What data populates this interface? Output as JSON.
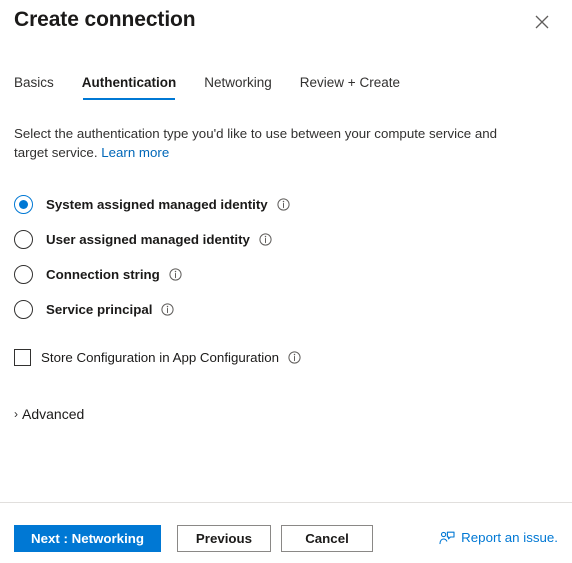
{
  "dialog": {
    "title": "Create connection",
    "close_icon": "close-icon"
  },
  "tabs": [
    {
      "label": "Basics",
      "active": false
    },
    {
      "label": "Authentication",
      "active": true
    },
    {
      "label": "Networking",
      "active": false
    },
    {
      "label": "Review + Create",
      "active": false
    }
  ],
  "description": {
    "text": "Select the authentication type you'd like to use between your compute service and target service.",
    "link_label": "Learn more"
  },
  "auth_options": [
    {
      "label": "System assigned managed identity",
      "selected": true,
      "info_icon": "info-icon"
    },
    {
      "label": "User assigned managed identity",
      "selected": false,
      "info_icon": "info-icon"
    },
    {
      "label": "Connection string",
      "selected": false,
      "info_icon": "info-icon"
    },
    {
      "label": "Service principal",
      "selected": false,
      "info_icon": "info-icon"
    }
  ],
  "store_config": {
    "label": "Store Configuration in App Configuration",
    "checked": false,
    "info_icon": "info-icon"
  },
  "advanced": {
    "label": "Advanced",
    "expanded": false,
    "chevron_icon": "chevron-right-icon"
  },
  "footer": {
    "next_label": "Next : Networking",
    "previous_label": "Previous",
    "cancel_label": "Cancel",
    "report_label": "Report an issue.",
    "report_icon": "feedback-person-icon"
  },
  "colors": {
    "accent": "#0078d4",
    "link": "#0067b8",
    "text": "#1b1a19",
    "border": "#8a8886",
    "divider": "#e1dfdd"
  }
}
